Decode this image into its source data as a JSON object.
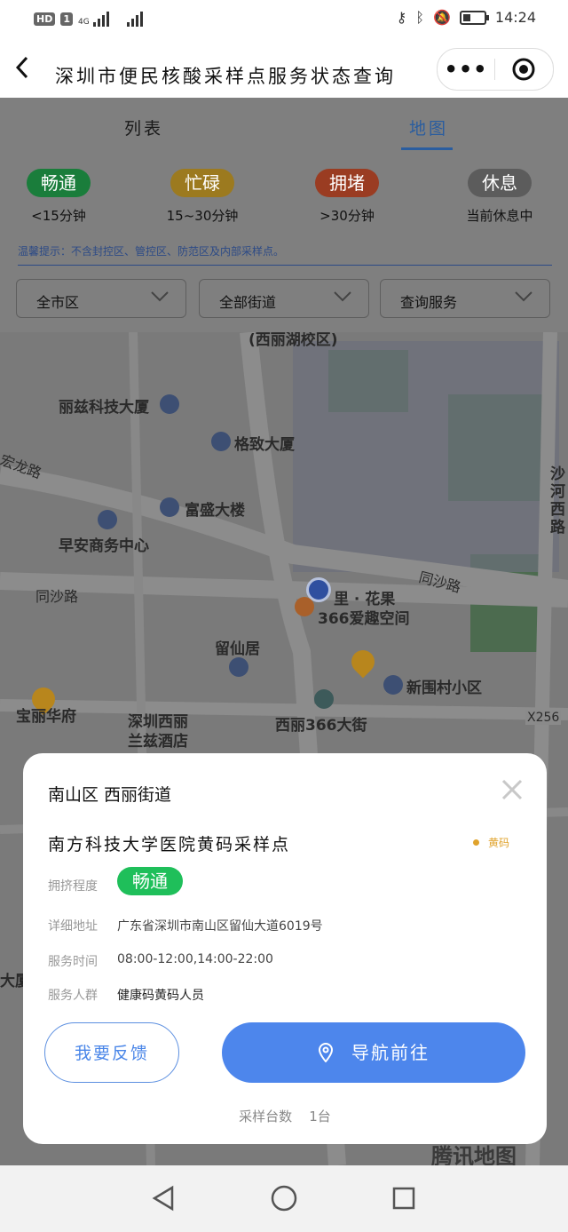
{
  "status_bar": {
    "hd": "HD",
    "sim": "1",
    "net": "4G",
    "time": "14:24"
  },
  "header": {
    "back_icon": "chevron-left-icon",
    "title": "深圳市便民核酸采样点服务状态查询",
    "more_icon": "more-dots-icon",
    "target_icon": "target-icon"
  },
  "tabs": [
    {
      "label": "列表"
    },
    {
      "label": "地图"
    }
  ],
  "legend": [
    {
      "label": "畅通",
      "desc": "<15分钟",
      "color": "#1fbf5a"
    },
    {
      "label": "忙碌",
      "desc": "15~30分钟",
      "color": "#e9b320"
    },
    {
      "label": "拥堵",
      "desc": ">30分钟",
      "color": "#e6532a"
    },
    {
      "label": "休息",
      "desc": "当前休息中",
      "color": "#8c8c8c"
    }
  ],
  "tip": "温馨提示：不含封控区、管控区、防范区及内部采样点。",
  "filters": [
    {
      "label": "全市区"
    },
    {
      "label": "全部街道"
    },
    {
      "label": "查询服务"
    }
  ],
  "map_labels": {
    "xili_campus": "(西丽湖校区)",
    "lizi": "丽兹科技大厦",
    "gezhi": "格致大厦",
    "fusheng": "富盛大楼",
    "zaoan": "早安商务中心",
    "tongsha1": "同沙路",
    "tongsha2": "同沙路",
    "lihua": "里 · 花果",
    "aiqu": "366爱趣空间",
    "liuxian": "留仙居",
    "xinwei": "新围村小区",
    "baoli": "宝丽华府",
    "xili_school": "深圳西丽",
    "lanzi": "兰兹酒店",
    "xili366": "西丽366大街",
    "x256": "X256",
    "shahe": "沙河西路",
    "longlu": "宏龙路",
    "dasha": "大厦",
    "watermark": "腾讯地图"
  },
  "card": {
    "district": "南山区   西丽街道",
    "site": "南方科技大学医院黄码采样点",
    "code": "黄码",
    "status_label": "拥挤程度",
    "status": "畅通",
    "address_label": "详细地址",
    "address": "广东省深圳市南山区留仙大道6019号",
    "hours_label": "服务时间",
    "hours": "08:00-12:00,14:00-22:00",
    "people_label": "服务人群",
    "people": "健康码黄码人员",
    "feedback": "我要反馈",
    "navigate": "导航前往",
    "count_label": "采样台数",
    "count": "1台"
  }
}
